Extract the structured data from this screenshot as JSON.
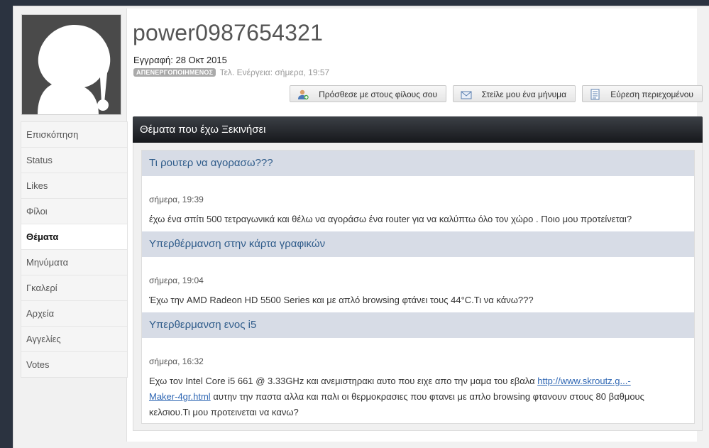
{
  "profile": {
    "username": "power0987654321",
    "joined": "Εγγραφή: 28 Οκτ 2015",
    "status_badge": "ΑΠΕΝΕΡΓΟΠΟΙΗΜΕΝΟΣ",
    "last_activity": "Τελ. Ενέργεια: σήμερα, 19:57"
  },
  "actions": {
    "add_friend": "Πρόσθεσε με στους φίλους σου",
    "send_message": "Στείλε μου ένα μήνυμα",
    "find_content": "Εύρεση περιεχομένου"
  },
  "sidebar": {
    "items": [
      {
        "label": "Επισκόπηση"
      },
      {
        "label": "Status"
      },
      {
        "label": "Likes"
      },
      {
        "label": "Φίλοι"
      },
      {
        "label": "Θέματα"
      },
      {
        "label": "Μηνύματα"
      },
      {
        "label": "Γκαλερί"
      },
      {
        "label": "Αρχεία"
      },
      {
        "label": "Αγγελίες"
      },
      {
        "label": "Votes"
      }
    ],
    "active_index": 4
  },
  "panel": {
    "title": "Θέματα που έχω Ξεκινήσει"
  },
  "threads": [
    {
      "title": "Τι ρουτερ να αγορασω???",
      "date": "σήμερα, 19:39",
      "body": "έχω ένα σπίτι 500 τετραγωνικά και θέλω να αγοράσω ένα router για να καλύπτω όλο τον χώρο . Ποιο μου προτείνεται?"
    },
    {
      "title": "Υπερθέρμανση στην κάρτα γραφικών",
      "date": "σήμερα, 19:04",
      "body": "Έχω την AMD Radeon HD 5500 Series και με απλό browsing φτάνει τους 44°C.Τι να κάνω???"
    },
    {
      "title": "Υπερθερμανση ενος i5",
      "date": "σήμερα, 16:32",
      "body_before": "Εχω τον Intel Core i5 661 @ 3.33GHz και ανεμιστηρακι αυτο που ειχε απο την μαμα του εβαλα ",
      "link_line1": "http://www.skroutz.g...-",
      "link_line2": "Maker-4gr.html",
      "body_after": " αυτην την παστα αλλα και παλι οι θερμοκρασιες που φτανει με απλο browsing φτανουν στους 80 βαθμους κελσιου.Τι μου προτεινεται να κανω?"
    }
  ],
  "colors": {
    "thread_title": "#2e5b8a",
    "thread_title_bg": "#d7dce6",
    "panel_header": "#16181c",
    "badge": "#aaaaaa"
  }
}
